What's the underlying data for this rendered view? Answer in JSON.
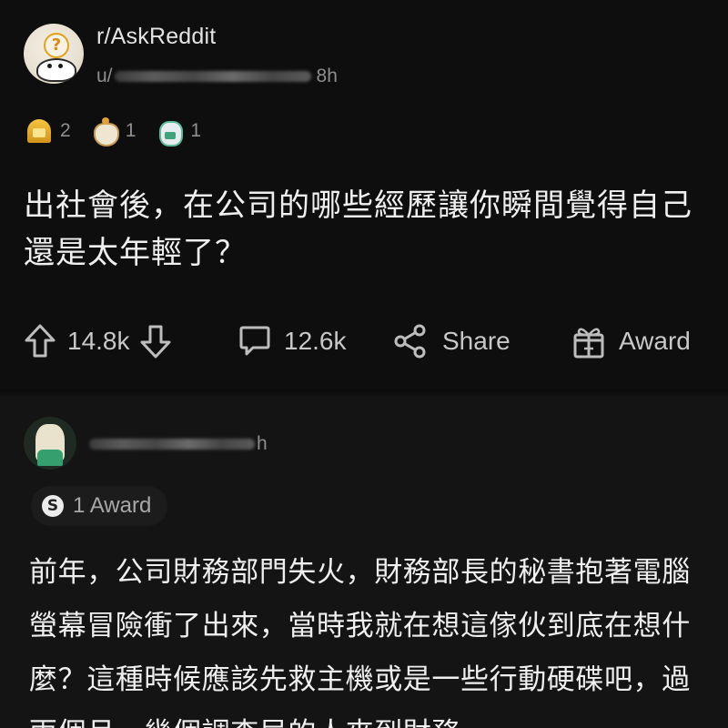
{
  "post": {
    "subreddit": "r/AskReddit",
    "user_prefix": "u/",
    "time": "8h",
    "awards": [
      {
        "icon": "gold-award-icon",
        "count": "2"
      },
      {
        "icon": "wholesome-award-icon",
        "count": "1"
      },
      {
        "icon": "helpful-award-icon",
        "count": "1"
      }
    ],
    "title": "出社會後，在公司的哪些經歷讓你瞬間覺得自己還是太年輕了？",
    "actions": {
      "upvotes": "14.8k",
      "comments": "12.6k",
      "share_label": "Share",
      "award_label": "Award"
    }
  },
  "comment": {
    "time_suffix": "h",
    "award_chip": {
      "icon": "silver-award-icon",
      "label": "1 Award"
    },
    "body": "前年，公司財務部門失火，財務部長的秘書抱著電腦螢幕冒險衝了出來，當時我就在想這傢伙到底在想什麼？這種時候應該先救主機或是一些行動硬碟吧，過兩個月，幾個調查局的人來到財務"
  },
  "colors": {
    "background": "#0e0e0e",
    "text": "#efefef",
    "muted": "#8d8d8d",
    "gold": "#d2921a"
  }
}
